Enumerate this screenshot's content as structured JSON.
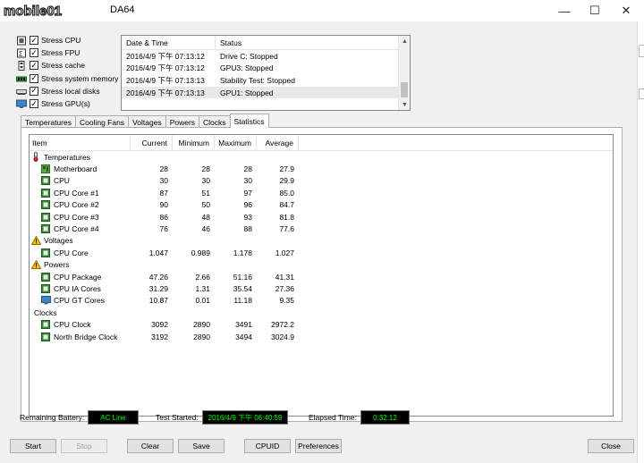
{
  "window": {
    "watermark_text": "mobile01",
    "title": "DA64",
    "minimize": "—",
    "maximize": "☐",
    "close": "✕"
  },
  "stress_options": [
    {
      "label": "Stress CPU",
      "checked": true,
      "icon": "cpu-icon"
    },
    {
      "label": "Stress FPU",
      "checked": true,
      "icon": "fpu-icon"
    },
    {
      "label": "Stress cache",
      "checked": true,
      "icon": "cache-icon"
    },
    {
      "label": "Stress system memory",
      "checked": true,
      "icon": "memory-icon"
    },
    {
      "label": "Stress local disks",
      "checked": true,
      "icon": "disk-icon"
    },
    {
      "label": "Stress GPU(s)",
      "checked": true,
      "icon": "gpu-icon"
    }
  ],
  "log": {
    "headers": [
      "Date & Time",
      "Status"
    ],
    "rows": [
      {
        "time": "2016/4/9 下午 07:13:12",
        "status": "Drive C: Stopped",
        "selected": false
      },
      {
        "time": "2016/4/9 下午 07:13:12",
        "status": "GPU3: Stopped",
        "selected": false
      },
      {
        "time": "2016/4/9 下午 07:13:13",
        "status": "Stability Test: Stopped",
        "selected": false
      },
      {
        "time": "2016/4/9 下午 07:13:13",
        "status": "GPU1: Stopped",
        "selected": true
      }
    ]
  },
  "tabs": [
    {
      "label": "Temperatures",
      "active": false
    },
    {
      "label": "Cooling Fans",
      "active": false
    },
    {
      "label": "Voltages",
      "active": false
    },
    {
      "label": "Powers",
      "active": false
    },
    {
      "label": "Clocks",
      "active": false
    },
    {
      "label": "Statistics",
      "active": true
    }
  ],
  "stats": {
    "headers": [
      "Item",
      "Current",
      "Minimum",
      "Maximum",
      "Average"
    ],
    "rows": [
      {
        "type": "group",
        "icon": "thermometer-icon",
        "label": "Temperatures"
      },
      {
        "type": "item",
        "icon": "motherboard-icon",
        "label": "Motherboard",
        "values": [
          "28",
          "28",
          "28",
          "27.9"
        ]
      },
      {
        "type": "item",
        "icon": "cpu-chip-icon",
        "label": "CPU",
        "values": [
          "30",
          "30",
          "30",
          "29.9"
        ]
      },
      {
        "type": "item",
        "icon": "cpu-chip-icon",
        "label": "CPU Core #1",
        "values": [
          "87",
          "51",
          "97",
          "85.0"
        ]
      },
      {
        "type": "item",
        "icon": "cpu-chip-icon",
        "label": "CPU Core #2",
        "values": [
          "90",
          "50",
          "96",
          "84.7"
        ]
      },
      {
        "type": "item",
        "icon": "cpu-chip-icon",
        "label": "CPU Core #3",
        "values": [
          "86",
          "48",
          "93",
          "81.8"
        ]
      },
      {
        "type": "item",
        "icon": "cpu-chip-icon",
        "label": "CPU Core #4",
        "values": [
          "76",
          "46",
          "88",
          "77.6"
        ]
      },
      {
        "type": "group",
        "icon": "warning-icon",
        "label": "Voltages"
      },
      {
        "type": "item",
        "icon": "cpu-chip-icon",
        "label": "CPU Core",
        "values": [
          "1.047",
          "0.989",
          "1.178",
          "1.027"
        ]
      },
      {
        "type": "group",
        "icon": "warning-icon",
        "label": "Powers"
      },
      {
        "type": "item",
        "icon": "cpu-chip-icon",
        "label": "CPU Package",
        "values": [
          "47.26",
          "2.66",
          "51.16",
          "41.31"
        ]
      },
      {
        "type": "item",
        "icon": "cpu-chip-icon",
        "label": "CPU IA Cores",
        "values": [
          "31.29",
          "1.31",
          "35.54",
          "27.36"
        ]
      },
      {
        "type": "item",
        "icon": "gpu-icon",
        "label": "CPU GT Cores",
        "values": [
          "10.87",
          "0.01",
          "11.18",
          "9.35"
        ]
      },
      {
        "type": "group",
        "icon": "clock-icon",
        "label": "Clocks"
      },
      {
        "type": "item",
        "icon": "cpu-chip-icon",
        "label": "CPU Clock",
        "values": [
          "3092",
          "2890",
          "3491",
          "2972.2"
        ]
      },
      {
        "type": "item",
        "icon": "cpu-chip-icon",
        "label": "North Bridge Clock",
        "values": [
          "3192",
          "2890",
          "3494",
          "3024.9"
        ]
      }
    ]
  },
  "status_bar": {
    "battery_label": "Remaining Battery:",
    "battery_value": "AC Line",
    "started_label": "Test Started:",
    "started_value": "2016/4/9 下午 06:40:59",
    "elapsed_label": "Elapsed Time:",
    "elapsed_value": "0:32:12"
  },
  "buttons": {
    "start": "Start",
    "stop": "Stop",
    "clear": "Clear",
    "save": "Save",
    "cpuid": "CPUID",
    "preferences": "Preferences",
    "close": "Close"
  },
  "colors": {
    "status_value_text": "#00ff00",
    "status_value_bg": "#000000",
    "chip_green": "#3a7a35",
    "warning_yellow": "#f5c400"
  }
}
